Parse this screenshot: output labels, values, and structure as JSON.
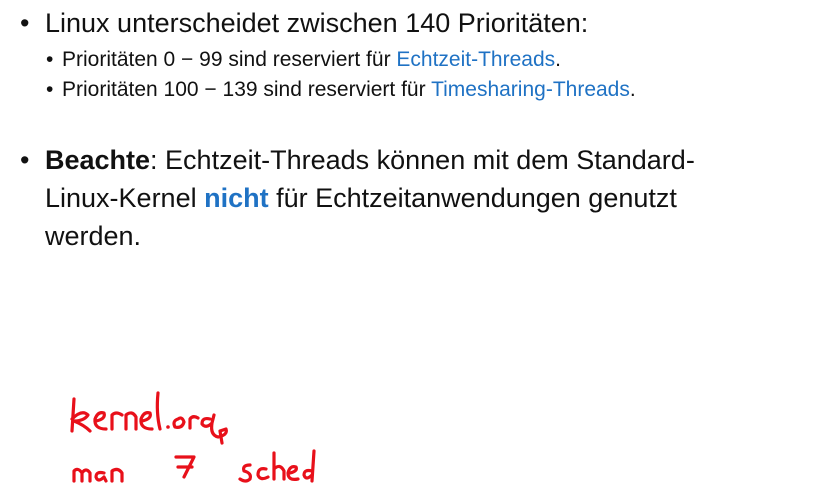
{
  "bullet1": {
    "text": "Linux unterscheidet zwischen 140 Prioritäten:",
    "sub1": {
      "prefix": "Prioritäten 0 − 99 sind reserviert für ",
      "link": "Echtzeit-Threads",
      "suffix": "."
    },
    "sub2": {
      "prefix": "Prioritäten 100 − 139 sind reserviert für ",
      "link": "Timesharing-Threads",
      "suffix": "."
    }
  },
  "bullet2": {
    "label": "Beachte",
    "line1_rest": ": Echtzeit-Threads können mit dem Standard-",
    "line2_prefix": "Linux-Kernel ",
    "emphasis": "nicht",
    "line2_suffix": " für Echtzeitanwendungen genutzt",
    "line3": "werden."
  },
  "handwritten_note": {
    "line1": "kernel.org",
    "line2": "man 7 sched",
    "color": "#e8101a"
  },
  "bullet_symbol": "•",
  "colors": {
    "link": "#1f72c4",
    "text": "#111111"
  }
}
